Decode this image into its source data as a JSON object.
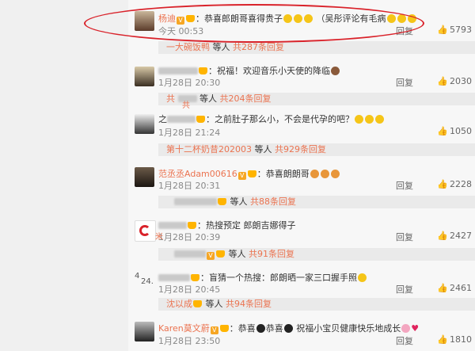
{
  "comments": [
    {
      "user": "杨迪",
      "text": "：恭喜郎朗哥喜得贵子",
      "extra": "（吴彤评论有毛病",
      "time": "今天 00:53",
      "reply": "回复",
      "likes": "5793"
    },
    {
      "user": "",
      "text": "：祝福！欢迎音乐小天使的降临",
      "time": "1月28日 20:30",
      "reply": "回复",
      "likes": "2030"
    },
    {
      "user": "之",
      "text": "：之前肚子那么小，不会是代孕的吧？",
      "time": "1月28日 21:24",
      "reply": "回复",
      "likes": "1050"
    },
    {
      "user": "范丞丞Adam00616",
      "text": "：恭喜朗朗哥",
      "time": "1月28日 20:31",
      "reply": "回复",
      "likes": "2228"
    },
    {
      "user": "",
      "text": "：热搜预定  郎朗吉娜得子",
      "time": "1月28日 20:39",
      "reply": "回复",
      "likes": "2427"
    },
    {
      "user": "",
      "text": "：盲猜一个热搜：郎朗晒一家三口握手照",
      "time": "1月28日 20:45",
      "reply": "回复",
      "likes": "2461"
    },
    {
      "user": "Karen莫文蔚",
      "text": "：恭喜",
      "text2": "恭喜",
      "text3": "祝福小宝贝健康快乐地成长",
      "time": "1月28日 23:50",
      "reply": "回复",
      "likes": "1810"
    }
  ],
  "subreplies": [
    {
      "user": "一大碗饭鸭",
      "mid": "等人",
      "count": "共287条回复"
    },
    {
      "user": "共",
      "mid": "等人",
      "count": "共204条回复"
    },
    {
      "user": "第十二杯奶昔202003",
      "mid": "等人",
      "count": "共929条回复"
    },
    {
      "user": "",
      "mid": "等人",
      "count": "共88条回复"
    },
    {
      "user": "",
      "mid": "等人",
      "count": "共91条回复"
    },
    {
      "user": "沈以成",
      "mid": "等人",
      "count": "共94条回复"
    }
  ],
  "left_marks": [
    "共",
    "米",
    "24.",
    "4"
  ]
}
